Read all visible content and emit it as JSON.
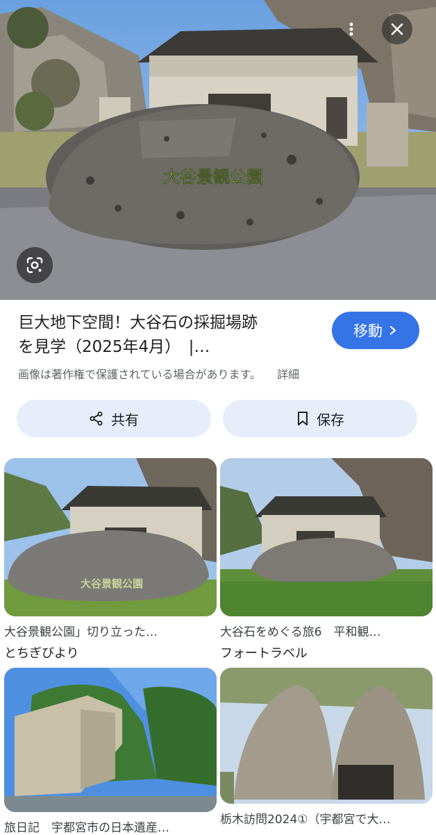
{
  "hero": {
    "sign_text": "大谷景観公園"
  },
  "controls": {
    "more_icon": "more-vert-icon",
    "close_icon": "close-icon",
    "lens_icon": "google-lens-icon"
  },
  "result": {
    "title_line1": "巨大地下空間！大谷石の採掘場跡",
    "title_line2": "を見学（2025年4月）　|…",
    "visit_label": "移動",
    "copyright_notice": "画像は著作権で保護されている場合があります。",
    "details_link": "詳細"
  },
  "actions": {
    "share_label": "共有",
    "save_label": "保存"
  },
  "related": [
    {
      "title": "大谷景観公園」切り立った…",
      "source": "とちぎびより"
    },
    {
      "title": "大谷石をめぐる旅6　平和観…",
      "source": "フォートラベル"
    },
    {
      "title": "旅日記　宇都宮市の日本遺産…",
      "source": ""
    },
    {
      "title": "栃木訪問2024①（宇都宮で大…",
      "source": ""
    }
  ],
  "colors": {
    "accent": "#3574e6",
    "pill_bg": "#e7eefa",
    "secondary_text": "#5f6368"
  }
}
